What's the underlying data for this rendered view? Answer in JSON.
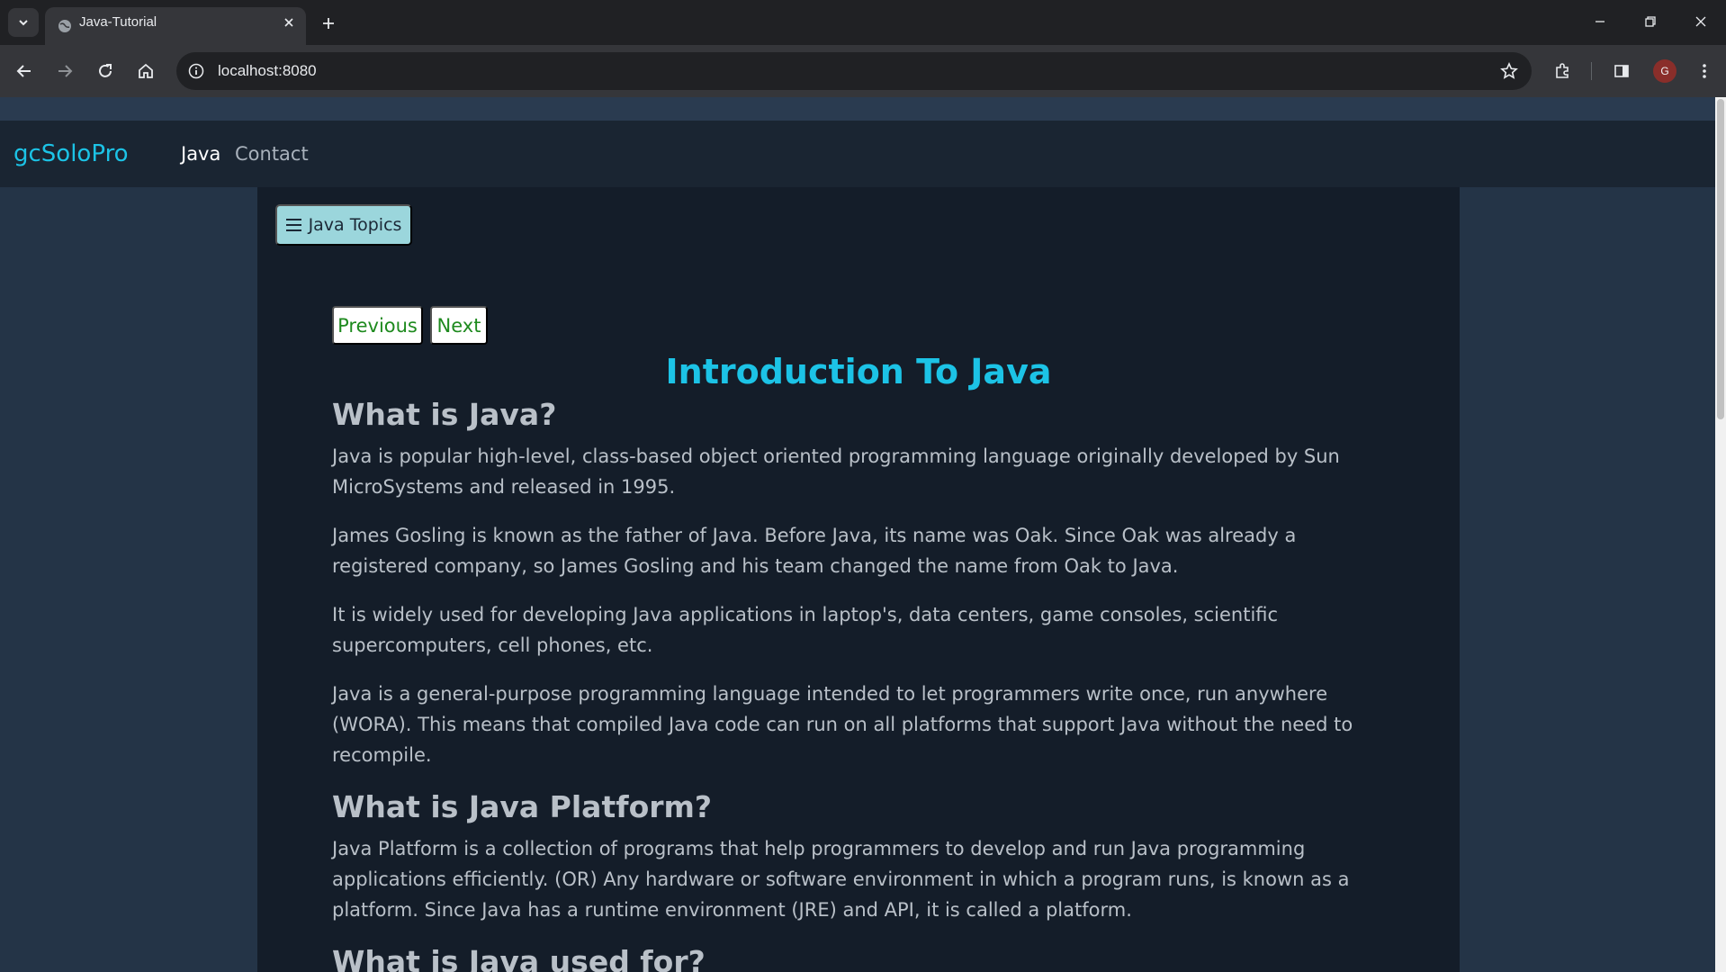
{
  "browser": {
    "tab": {
      "title": "Java-Tutorial",
      "favicon": "globe-icon"
    },
    "address": "localhost:8080",
    "profile_initial": "G",
    "icons": [
      "tab-search-icon",
      "close-icon",
      "plus-icon",
      "minimize-icon",
      "restore-icon",
      "close-window-icon",
      "back-arrow-icon",
      "forward-arrow-icon",
      "reload-icon",
      "home-icon",
      "info-icon",
      "star-icon",
      "extensions-icon",
      "side-panel-icon",
      "kebab-menu-icon"
    ]
  },
  "site": {
    "brand": "gcSoloPro",
    "nav": {
      "java": "Java",
      "contact": "Contact"
    },
    "brand_color": "#1cc3e6"
  },
  "page": {
    "topics_button": "Java Topics",
    "pager": {
      "previous": "Previous",
      "next": "Next"
    },
    "title": "Introduction To Java",
    "sections": [
      {
        "heading": "What is Java?",
        "paragraphs": [
          "Java is popular high-level, class-based object oriented programming language originally developed by Sun MicroSystems and released in 1995.",
          "James Gosling is known as the father of Java. Before Java, its name was Oak. Since Oak was already a registered company, so James Gosling and his team changed the name from Oak to Java.",
          "It is widely used for developing Java applications in laptop's, data centers, game consoles, scientific supercomputers, cell phones, etc.",
          "Java is a general-purpose programming language intended to let programmers write once, run anywhere (WORA). This means that compiled Java code can run on all platforms that support Java without the need to recompile."
        ]
      },
      {
        "heading": "What is Java Platform?",
        "paragraphs": [
          "Java Platform is a collection of programs that help programmers to develop and run Java programming applications efficiently. (OR) Any hardware or software environment in which a program runs, is known as a platform. Since Java has a runtime environment (JRE) and API, it is called a platform."
        ]
      },
      {
        "heading": "What is Java used for?",
        "paragraphs": []
      }
    ]
  }
}
